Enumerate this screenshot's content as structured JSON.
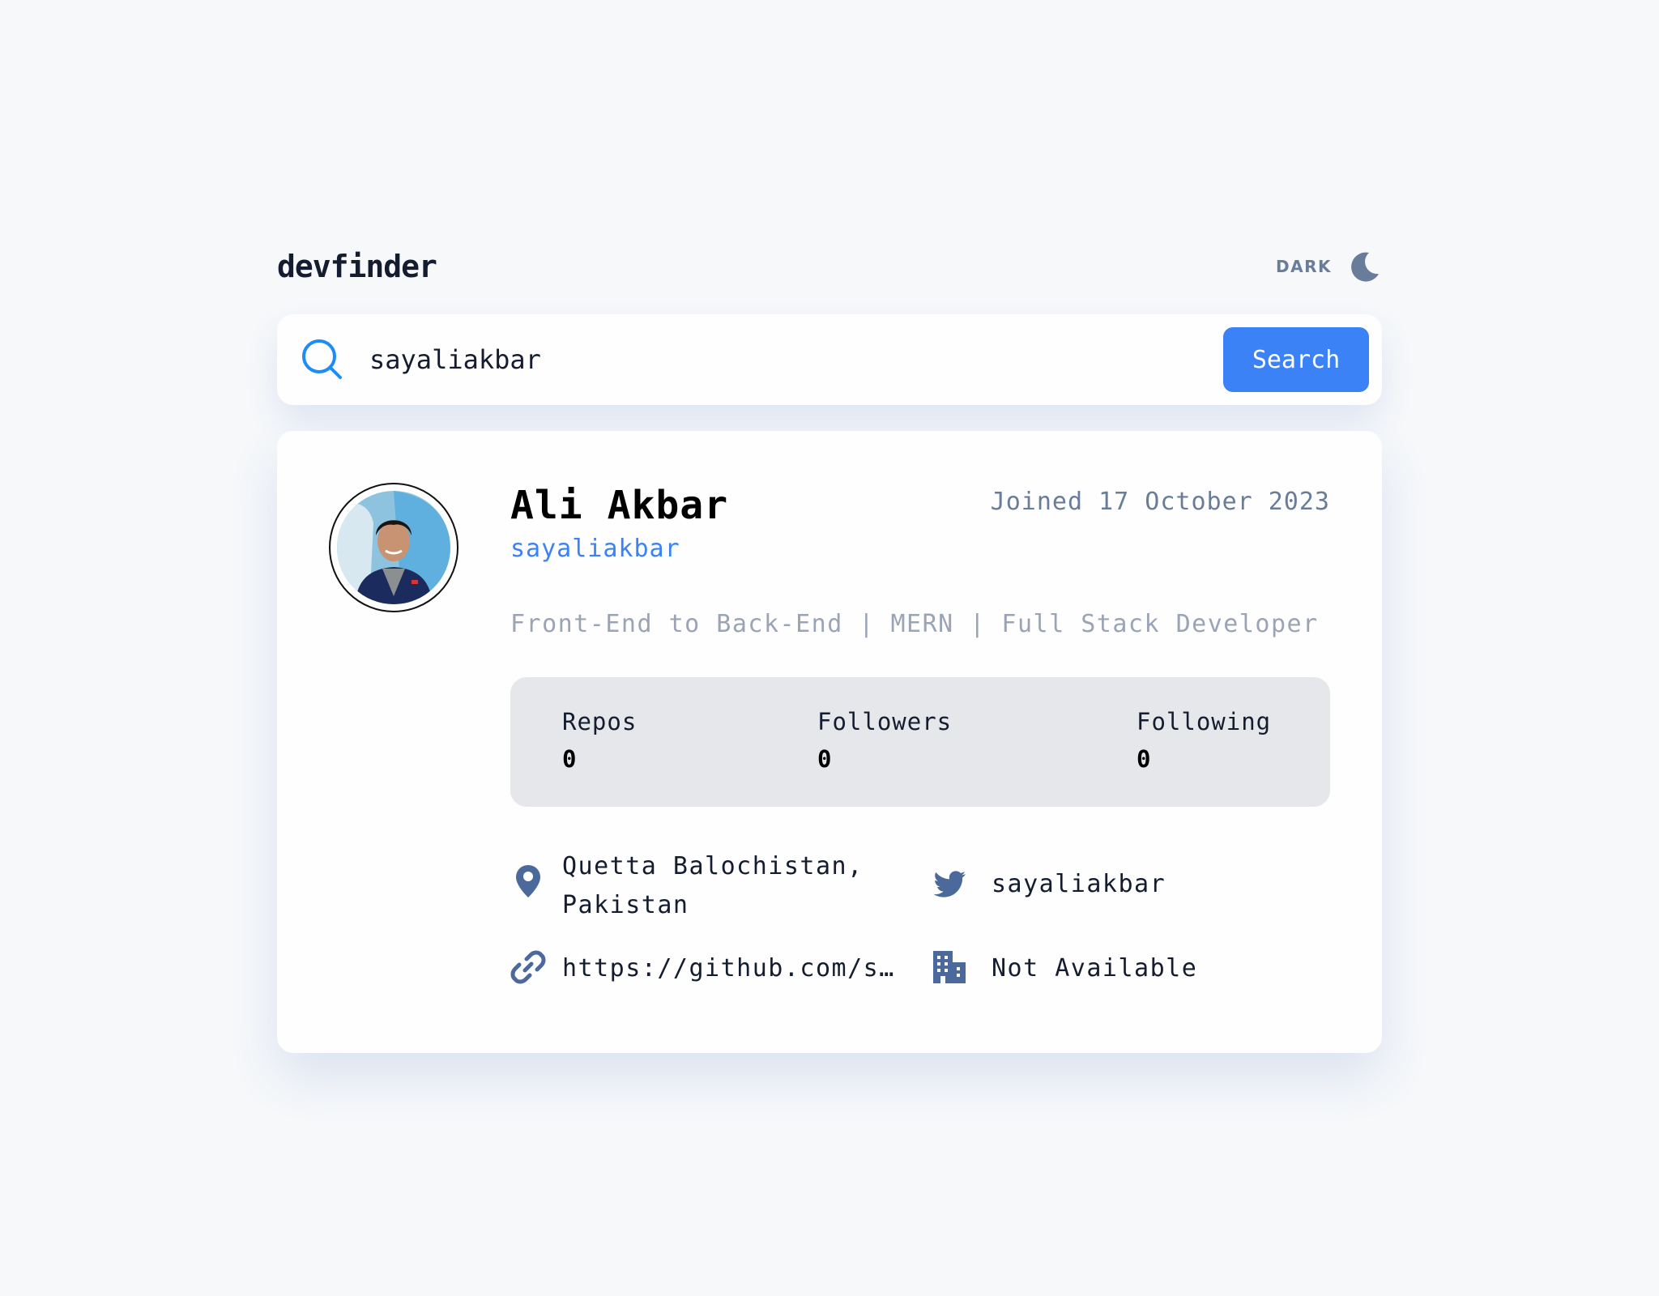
{
  "app": {
    "logo": "devfinder",
    "theme_label": "DARK"
  },
  "search": {
    "value": "sayaliakbar",
    "button_label": "Search"
  },
  "profile": {
    "name": "Ali Akbar",
    "login": "sayaliakbar",
    "joined": "Joined 17 October 2023",
    "bio": "Front-End to Back-End | MERN | Full Stack Developer",
    "stats": [
      {
        "label": "Repos",
        "value": "0"
      },
      {
        "label": "Followers",
        "value": "0"
      },
      {
        "label": "Following",
        "value": "0"
      }
    ],
    "location": "Quetta Balochistan, Pakistan",
    "twitter": "sayaliakbar",
    "blog": "https://github.com/sayaliakbar",
    "company": "Not Available"
  },
  "colors": {
    "accent": "#3b82f6",
    "background": "#f6f8fa",
    "icon": "#4b6a9b",
    "muted": "#697c9a"
  },
  "icons": {
    "theme": "moon-icon",
    "search": "search-icon",
    "location": "location-pin-icon",
    "twitter": "twitter-icon",
    "blog": "link-icon",
    "company": "building-icon"
  }
}
